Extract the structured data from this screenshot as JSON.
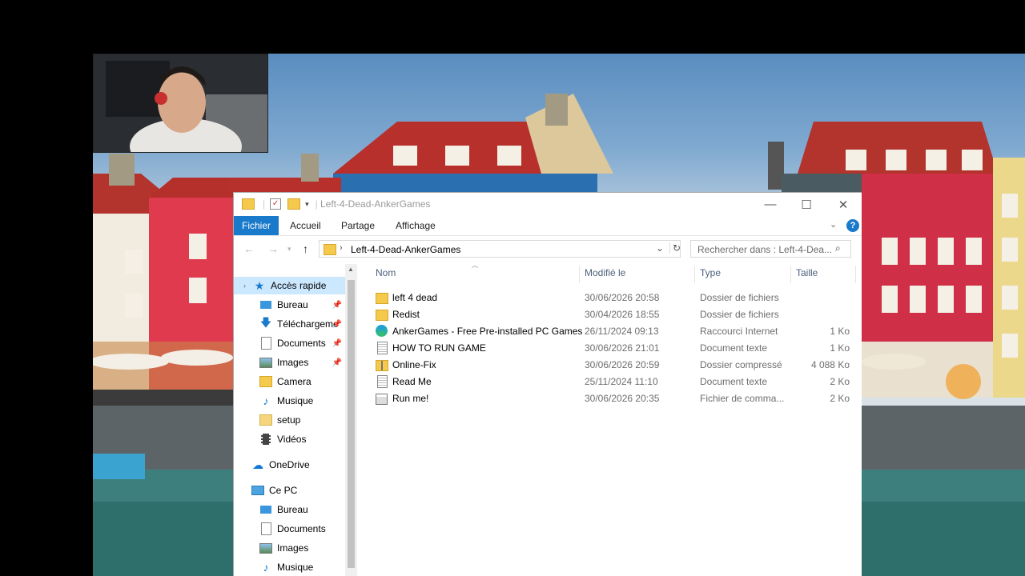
{
  "window": {
    "title": "Left-4-Dead-AnkerGames",
    "minimize": "—",
    "maximize": "☐",
    "close": "✕"
  },
  "ribbon": {
    "tabs": [
      "Fichier",
      "Accueil",
      "Partage",
      "Affichage"
    ],
    "help": "?"
  },
  "address": {
    "path": "Left-4-Dead-AnkerGames",
    "search_placeholder": "Rechercher dans : Left-4-Dea..."
  },
  "sidebar": {
    "items": [
      {
        "label": "Accès rapide",
        "icon": "star-icon",
        "pinned": false,
        "selected": true
      },
      {
        "label": "Bureau",
        "icon": "desktop-icon",
        "pinned": true
      },
      {
        "label": "Téléchargements",
        "icon": "download-icon",
        "pinned": true
      },
      {
        "label": "Documents",
        "icon": "document-icon",
        "pinned": true
      },
      {
        "label": "Images",
        "icon": "image-icon",
        "pinned": true
      },
      {
        "label": "Camera",
        "icon": "folder-icon",
        "pinned": false
      },
      {
        "label": "Musique",
        "icon": "music-icon",
        "pinned": false
      },
      {
        "label": "setup",
        "icon": "folder-icon",
        "pinned": false
      },
      {
        "label": "Vidéos",
        "icon": "video-icon",
        "pinned": false
      },
      {
        "label": "OneDrive",
        "icon": "cloud-icon",
        "pinned": false
      },
      {
        "label": "Ce PC",
        "icon": "computer-icon",
        "pinned": false
      },
      {
        "label": "Bureau",
        "icon": "desktop-icon",
        "pinned": false
      },
      {
        "label": "Documents",
        "icon": "document-icon",
        "pinned": false
      },
      {
        "label": "Images",
        "icon": "image-icon",
        "pinned": false
      },
      {
        "label": "Musique",
        "icon": "music-icon",
        "pinned": false
      }
    ]
  },
  "columns": {
    "name": "Nom",
    "modified": "Modifié le",
    "type": "Type",
    "size": "Taille"
  },
  "files": [
    {
      "name": "left 4 dead",
      "modified": "30/06/2026 20:58",
      "type": "Dossier de fichiers",
      "size": "",
      "icon": "folder-icon"
    },
    {
      "name": "Redist",
      "modified": "30/04/2026 18:55",
      "type": "Dossier de fichiers",
      "size": "",
      "icon": "folder-icon"
    },
    {
      "name": "AnkerGames - Free Pre-installed PC Games",
      "modified": "26/11/2024 09:13",
      "type": "Raccourci Internet",
      "size": "1 Ko",
      "icon": "edge-shortcut-icon"
    },
    {
      "name": "HOW TO RUN GAME",
      "modified": "30/06/2026 21:01",
      "type": "Document texte",
      "size": "1 Ko",
      "icon": "text-file-icon"
    },
    {
      "name": "Online-Fix",
      "modified": "30/06/2026 20:59",
      "type": "Dossier compressé",
      "size": "4 088 Ko",
      "icon": "zip-folder-icon"
    },
    {
      "name": "Read Me",
      "modified": "25/11/2024 11:10",
      "type": "Document texte",
      "size": "2 Ko",
      "icon": "text-file-icon"
    },
    {
      "name": "Run me!",
      "modified": "30/06/2026 20:35",
      "type": "Fichier de comma...",
      "size": "2 Ko",
      "icon": "batch-file-icon"
    }
  ],
  "colors": {
    "accent": "#1979ca",
    "selection": "#cce8ff"
  }
}
